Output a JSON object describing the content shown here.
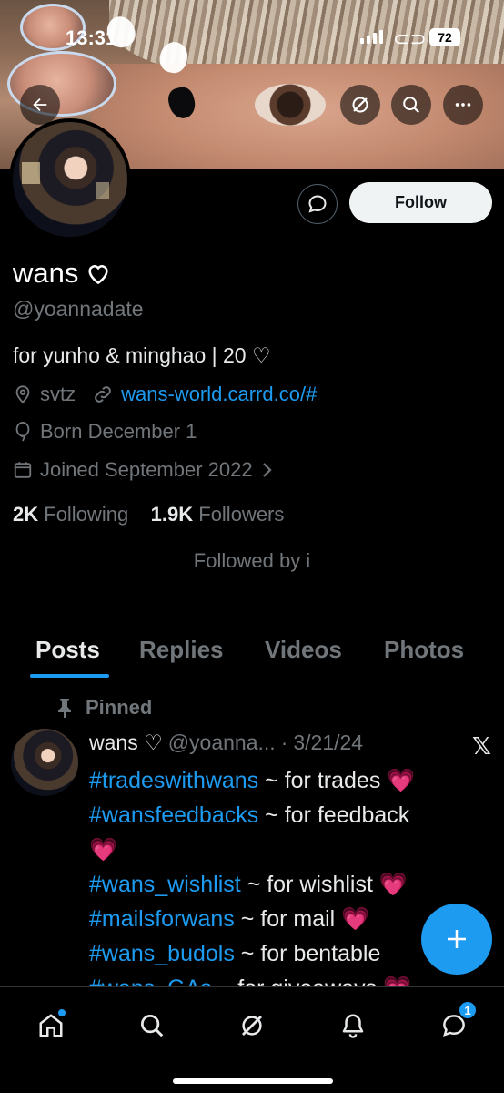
{
  "status_bar": {
    "time": "13:31",
    "battery": "72"
  },
  "profile": {
    "display_name": "wans",
    "handle": "@yoannadate",
    "bio": "for yunho & minghao | 20 ♡",
    "location": "svtz",
    "website": "wans-world.carrd.co/#",
    "birthday": "Born December 1",
    "joined": "Joined September 2022",
    "following_count": "2K",
    "following_label": "Following",
    "followers_count": "1.9K",
    "followers_label": "Followers",
    "followed_by": "Followed by i"
  },
  "actions": {
    "follow_label": "Follow"
  },
  "tabs": [
    {
      "label": "Posts",
      "active": true
    },
    {
      "label": "Replies",
      "active": false
    },
    {
      "label": "Videos",
      "active": false
    },
    {
      "label": "Photos",
      "active": false
    }
  ],
  "post": {
    "pinned_label": "Pinned",
    "author_name": "wans ♡",
    "author_handle": "@yoanna...",
    "separator": "·",
    "date": "3/21/24",
    "lines": [
      {
        "tag": "#tradeswithwans",
        "text": " ~ for trades ",
        "emoji": "💗"
      },
      {
        "tag": "#wansfeedbacks",
        "text": " ~ for feedback ",
        "emoji": ""
      },
      {
        "tag": "",
        "text": "",
        "emoji": "💗"
      },
      {
        "tag": "#wans_wishlist",
        "text": " ~ for wishlist ",
        "emoji": "💗"
      },
      {
        "tag": "#mailsforwans",
        "text": " ~ for mail ",
        "emoji": "💗"
      },
      {
        "tag": "#wans_budols",
        "text": " ~ for bentable",
        "emoji": ""
      },
      {
        "tag": "#wans_GAs",
        "text": " ~ for giveaways ",
        "emoji": "💗"
      }
    ]
  },
  "nav": {
    "messages_badge": "1"
  },
  "colors": {
    "accent": "#1d9bf0",
    "muted": "#71767b",
    "text": "#e7e9ea",
    "background": "#000000"
  }
}
